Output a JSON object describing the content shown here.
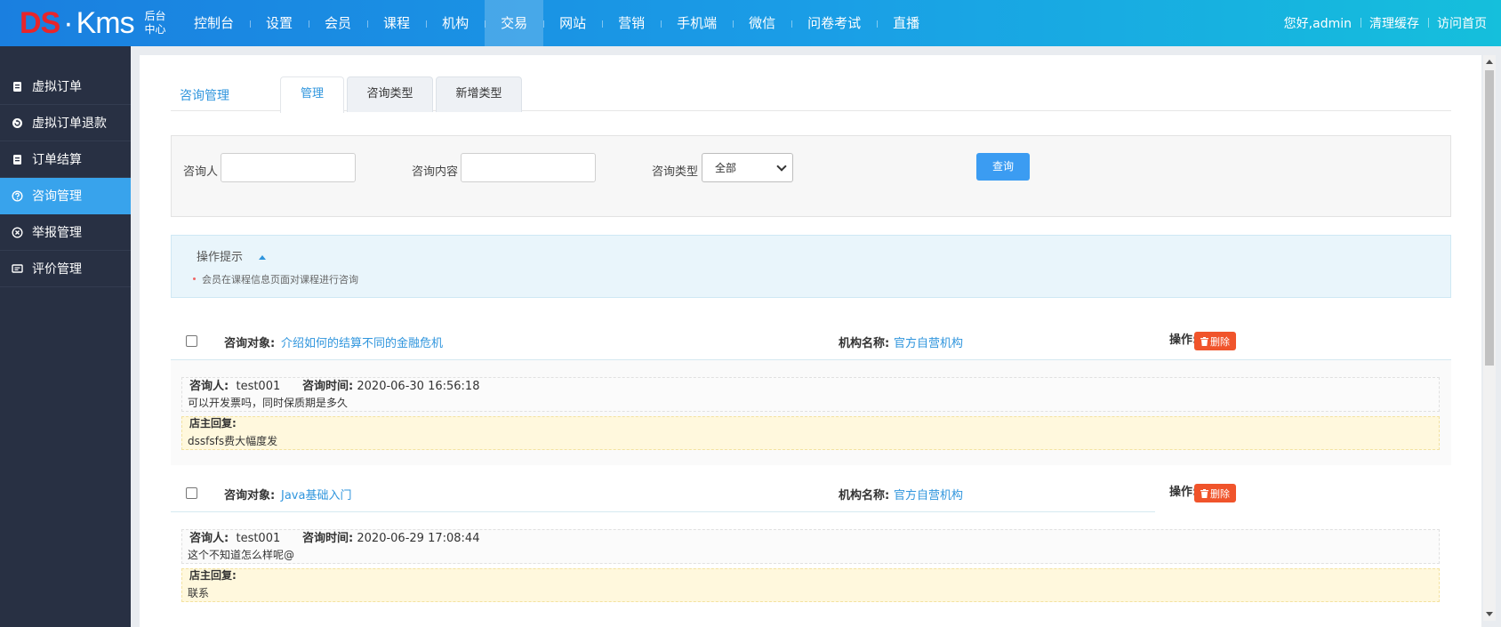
{
  "brand": {
    "ds": "DS",
    "dot": "·",
    "kms": "Kms",
    "sub": "后台\n中心"
  },
  "nav": [
    "控制台",
    "设置",
    "会员",
    "课程",
    "机构",
    "交易",
    "网站",
    "营销",
    "手机端",
    "微信",
    "问卷考试",
    "直播"
  ],
  "nav_active": "交易",
  "top_right": [
    "您好,admin",
    "清理缓存",
    "访问首页"
  ],
  "sidebar": {
    "items": [
      {
        "label": "虚拟订单",
        "icon": "order-icon"
      },
      {
        "label": "虚拟订单退款",
        "icon": "refund-icon"
      },
      {
        "label": "订单结算",
        "icon": "settlement-icon"
      },
      {
        "label": "咨询管理",
        "icon": "question-circle-icon"
      },
      {
        "label": "举报管理",
        "icon": "close-circle-icon"
      },
      {
        "label": "评价管理",
        "icon": "comment-icon"
      }
    ],
    "active": "咨询管理"
  },
  "page": {
    "crumb": "咨询管理",
    "tabs": [
      "管理",
      "咨询类型",
      "新增类型"
    ],
    "active_tab": "管理"
  },
  "search": {
    "consulter_label": "咨询人",
    "consulter_value": "",
    "content_label": "咨询内容",
    "content_value": "",
    "type_label": "咨询类型",
    "type_selected": "全部",
    "query_button": "查询"
  },
  "tips": {
    "title": "操作提示",
    "items": [
      "会员在课程信息页面对课程进行咨询"
    ]
  },
  "labels": {
    "object": "咨询对象:",
    "org": "机构名称:",
    "op": "操作:",
    "delete": "删除",
    "consulter": "咨询人:",
    "time": "咨询时间:",
    "reply": "店主回复:"
  },
  "records": [
    {
      "object": "介绍如何的结算不同的金融危机",
      "org": "官方自营机构",
      "consulter": "test001",
      "time": "2020-06-30 16:56:18",
      "question": "可以开发票吗，同时保质期是多久",
      "reply": "dssfsfs费大幅度发"
    },
    {
      "object": "Java基础入门",
      "org": "官方自营机构",
      "consulter": "test001",
      "time": "2020-06-29 17:08:44",
      "question": "这个不知道怎么样呢@",
      "reply": "联系"
    }
  ],
  "colors": {
    "accent": "#38a3ec",
    "link": "#2f95dd",
    "danger": "#f0542b",
    "sidebar": "#283043",
    "reply_bg": "#fff8dd"
  }
}
